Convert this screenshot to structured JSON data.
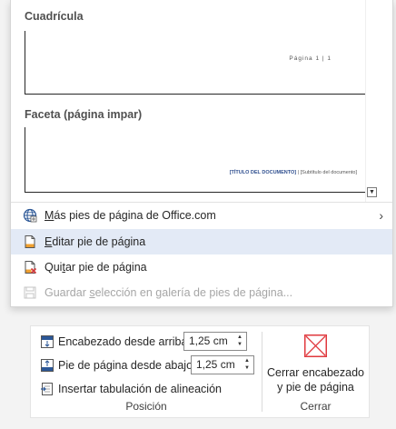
{
  "gallery": {
    "sections": [
      {
        "header": "Cuadrícula",
        "preview_text": "Página 1 | 1"
      },
      {
        "header": "Faceta (página impar)",
        "preview_title": "[TÍTULO DEL DOCUMENTO]",
        "preview_subtitle": " | [Subtítulo del documento]"
      }
    ]
  },
  "menu": {
    "items": [
      {
        "pre": "",
        "key": "M",
        "post": "ás pies de página de Office.com",
        "icon": "globe-icon",
        "has_submenu": true,
        "state": "normal"
      },
      {
        "pre": "",
        "key": "E",
        "post": "ditar pie de página",
        "icon": "edit-footer-icon",
        "state": "hover"
      },
      {
        "pre": "Qui",
        "key": "t",
        "post": "ar pie de página",
        "icon": "remove-footer-icon",
        "state": "normal"
      },
      {
        "pre": "Guardar ",
        "key": "s",
        "post": "elección en galería de pies de página...",
        "icon": "save-selection-icon",
        "state": "disabled"
      }
    ]
  },
  "ribbon": {
    "position_group": {
      "label": "Posición",
      "header_from_top": {
        "label": "Encabezado desde arriba:",
        "value": "1,25 cm"
      },
      "footer_from_bottom": {
        "label": "Pie de página desde abajo:",
        "value": "1,25 cm"
      },
      "insert_tab": {
        "label": "Insertar tabulación de alineación"
      }
    },
    "close_group": {
      "label": "Cerrar",
      "button_line1": "Cerrar encabezado",
      "button_line2": "y pie de página"
    }
  },
  "colors": {
    "hover_bg": "#e3eaf6",
    "close_red": "#e0393e",
    "accent_blue": "#2b5797",
    "disabled_text": "#a6a6a6"
  }
}
